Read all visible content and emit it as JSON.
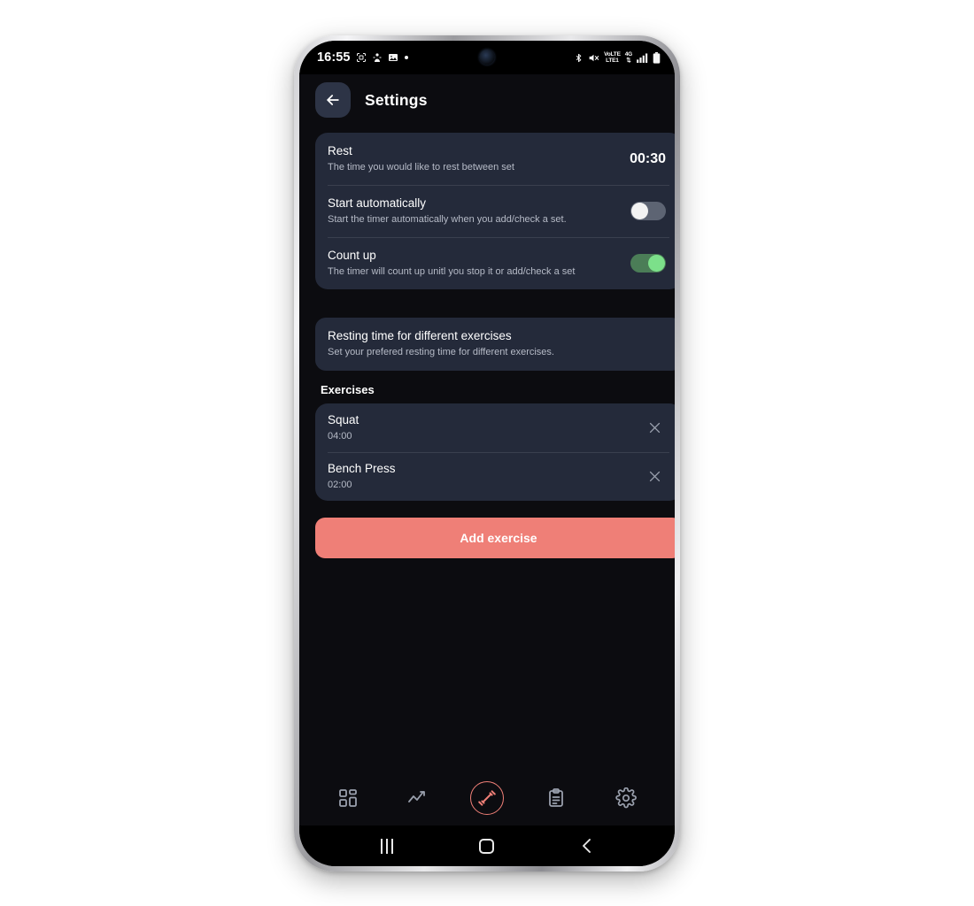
{
  "status_bar": {
    "time": "16:55",
    "left_icons": [
      "screenshot-icon",
      "app-notification-icon",
      "gallery-icon",
      "dot-indicator"
    ],
    "right_icons": [
      "bluetooth-icon",
      "mute-icon",
      "volte-icon",
      "network-4g-icon",
      "signal-icon",
      "battery-icon"
    ],
    "volte_label_top": "VoLTE",
    "volte_label_bottom": "LTE1",
    "network_label": "4G"
  },
  "header": {
    "title": "Settings",
    "back_label": "Back"
  },
  "settings_card": {
    "rows": [
      {
        "title": "Rest",
        "subtitle": "The time you would like to rest between set",
        "value": "00:30",
        "control": "value"
      },
      {
        "title": "Start automatically",
        "subtitle": "Start the timer automatically when you add/check a set.",
        "control": "toggle",
        "toggle_state": "off"
      },
      {
        "title": "Count up",
        "subtitle": "The timer will count up unitl you stop it or add/check a set",
        "control": "toggle",
        "toggle_state": "on"
      }
    ]
  },
  "resting_info": {
    "title": "Resting time for different exercises",
    "subtitle": "Set your prefered resting time for different exercises."
  },
  "exercises_section": {
    "heading": "Exercises",
    "items": [
      {
        "name": "Squat",
        "time": "04:00",
        "delete_label": "Remove"
      },
      {
        "name": "Bench Press",
        "time": "02:00",
        "delete_label": "Remove"
      }
    ]
  },
  "add_button": {
    "label": "Add exercise"
  },
  "tabbar": {
    "tabs": [
      {
        "name": "dashboard-tab",
        "icon": "grid-icon",
        "active": false
      },
      {
        "name": "statistics-tab",
        "icon": "trending-line-icon",
        "active": false
      },
      {
        "name": "workout-tab",
        "icon": "dumbbell-icon",
        "active": true
      },
      {
        "name": "log-tab",
        "icon": "clipboard-icon",
        "active": false
      },
      {
        "name": "settings-tab",
        "icon": "gear-icon",
        "active": false
      }
    ]
  },
  "system_nav": {
    "recents_label": "Recents",
    "home_label": "Home",
    "back_label": "Back"
  },
  "colors": {
    "accent": "#ef7f77",
    "card": "#242a3a",
    "background": "#0c0c10",
    "toggle_on": "#7ce08a",
    "toggle_off_track": "#5d6473",
    "text_primary": "#ffffff",
    "text_secondary": "#b6bbc7"
  }
}
